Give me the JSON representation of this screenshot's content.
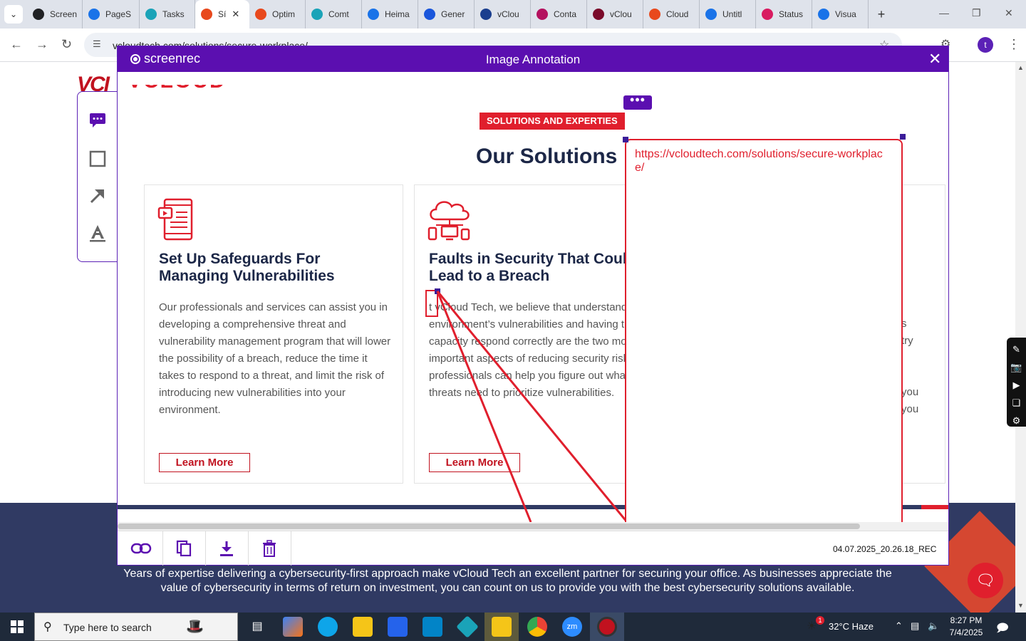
{
  "browser": {
    "tabs": [
      {
        "label": "Screen",
        "fav": "#202124"
      },
      {
        "label": "PageS",
        "fav": "#1a73e8"
      },
      {
        "label": "Tasks",
        "fav": "#1aa3b8"
      },
      {
        "label": "Sí",
        "fav": "#e8491d",
        "active": true
      },
      {
        "label": "Optim",
        "fav": "#e8491d"
      },
      {
        "label": "Comt",
        "fav": "#1aa3b8"
      },
      {
        "label": "Heima",
        "fav": "#1a73e8"
      },
      {
        "label": "Gener",
        "fav": "#1a56db"
      },
      {
        "label": "vClou",
        "fav": "#1a3e8e"
      },
      {
        "label": "Conta",
        "fav": "#b4125f"
      },
      {
        "label": "vClou",
        "fav": "#7a0a2a"
      },
      {
        "label": "Cloud",
        "fav": "#e8491d"
      },
      {
        "label": "Untitl",
        "fav": "#1a73e8"
      },
      {
        "label": "Status",
        "fav": "#d81b60"
      },
      {
        "label": "Visua",
        "fav": "#1a73e8"
      }
    ],
    "url": "vcloudtech.com/solutions/secure-workplace/",
    "profile_initial": "t"
  },
  "site": {
    "logo": "VCI",
    "footer_text": "Years of expertise delivering a cybersecurity-first approach make vCloud Tech an excellent partner for securing your office. As businesses appreciate the value of cybersecurity in terms of return on investment, you can count on us to provide you with the best cybersecurity solutions available."
  },
  "dialog": {
    "brand": "screenrec",
    "title": "Image Annotation",
    "filename": "04.07.2025_20.26.18_REC",
    "more_label": "•••"
  },
  "capture": {
    "logo_fragment": "VCLOUD TECH",
    "section_tag": "SOLUTIONS AND EXPERTIES",
    "section_title": "Our Solutions",
    "cards": [
      {
        "title": "Set Up Safeguards For Managing Vulnerabilities",
        "body": "Our professionals and services can assist you in developing a comprehensive threat and vulnerability management program that will lower the possibility of a breach, reduce the time it takes to respond to a threat, and limit the risk of introducing new vulnerabilities into your environment.",
        "button": "Learn More"
      },
      {
        "title": "Faults in Security That Could Lead to a Breach",
        "body": "t vCloud Tech, we believe that understanding environment’s vulnerabilities and having the capacity respond correctly are the two most important aspects of reducing security risk. Our professionals can help you figure out what threats need to prioritize vulnerabilities.",
        "button": "Learn More"
      }
    ],
    "card3_fragment": "s\ntry\n\n\nyou\nyou",
    "annotation_text": "https://vcloudtech.com/solutions/secure-workplace/"
  },
  "taskbar": {
    "search_placeholder": "Type here to search",
    "weather": "32°C  Haze",
    "time": "8:27 PM",
    "date": "7/4/2025",
    "weather_badge": "1"
  },
  "colors": {
    "accent_purple": "#5b0fb0",
    "brand_red": "#e01f2d",
    "navy": "#1c2747",
    "footer_navy": "#303a63"
  }
}
